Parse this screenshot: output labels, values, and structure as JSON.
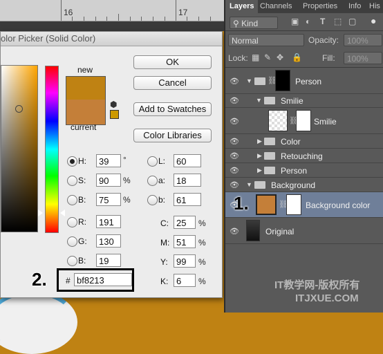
{
  "ruler": {
    "mark_16": "16",
    "mark_17": "17"
  },
  "dialog": {
    "title": "olor Picker (Solid Color)",
    "new_label": "new",
    "current_label": "current",
    "new_color": "#bf8213",
    "current_color": "#c47f39",
    "buttons": {
      "ok": "OK",
      "cancel": "Cancel",
      "add_swatches": "Add to Swatches",
      "color_libraries": "Color Libraries"
    },
    "hsb": {
      "h_label": "H:",
      "h": "39",
      "h_unit": "°",
      "s_label": "S:",
      "s": "90",
      "s_unit": "%",
      "b_label": "B:",
      "b": "75",
      "b_unit": "%"
    },
    "rgb": {
      "r_label": "R:",
      "r": "191",
      "g_label": "G:",
      "g": "130",
      "b_label": "B:",
      "b": "19"
    },
    "lab": {
      "l_label": "L:",
      "l": "60",
      "a_label": "a:",
      "a": "18",
      "b_label": "b:",
      "b": "61"
    },
    "cmyk": {
      "c_label": "C:",
      "c": "25",
      "m_label": "M:",
      "m": "51",
      "y_label": "Y:",
      "y": "99",
      "k_label": "K:",
      "k": "6",
      "unit": "%"
    },
    "hex_label": "#",
    "hex": "bf8213"
  },
  "steps": {
    "one": "1.",
    "two": "2."
  },
  "layers_panel": {
    "tabs": [
      "Layers",
      "Channels",
      "Properties",
      "Info",
      "His"
    ],
    "kind_label": "Kind",
    "blend_mode": "Normal",
    "opacity_label": "Opacity:",
    "opacity": "100%",
    "lock_label": "Lock:",
    "fill_label": "Fill:",
    "fill": "100%",
    "layers": [
      {
        "name": "Person"
      },
      {
        "name": "Smilie"
      },
      {
        "name": "Smilie"
      },
      {
        "name": "Color"
      },
      {
        "name": "Retouching"
      },
      {
        "name": "Person"
      },
      {
        "name": "Background"
      },
      {
        "name": "Background color"
      },
      {
        "name": "Original"
      }
    ]
  },
  "watermark": {
    "line1": "IT教学网-版权所有",
    "line2": "ITJXUE.COM"
  }
}
